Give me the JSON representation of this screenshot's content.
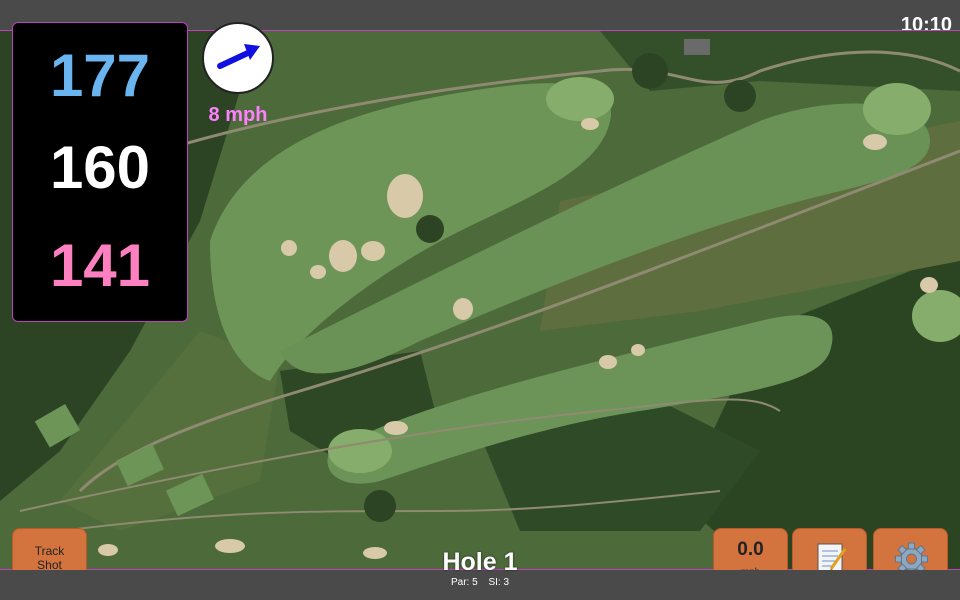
{
  "status_bar": {
    "time": "10:10"
  },
  "yardages": {
    "back": "177",
    "middle": "160",
    "front": "141",
    "back_color": "#6ab4f0",
    "middle_color": "#ffffff",
    "front_color": "#ff80c0"
  },
  "wind": {
    "speed_label": "8 mph",
    "direction_icon": "arrow-northeast",
    "arrow_color": "#1010e0",
    "label_color": "#ff80ff"
  },
  "buttons": {
    "track_shot": {
      "line1": "Track",
      "line2": "Shot"
    },
    "wind_speed": {
      "value": "0.0",
      "unit": "mph"
    },
    "notes_icon": "notepad-icon",
    "settings_icon": "gear-icon",
    "accent_color": "#d3743f"
  },
  "hole": {
    "title": "Hole 1",
    "par_label": "Par: 5",
    "si_label": "SI: 3"
  }
}
